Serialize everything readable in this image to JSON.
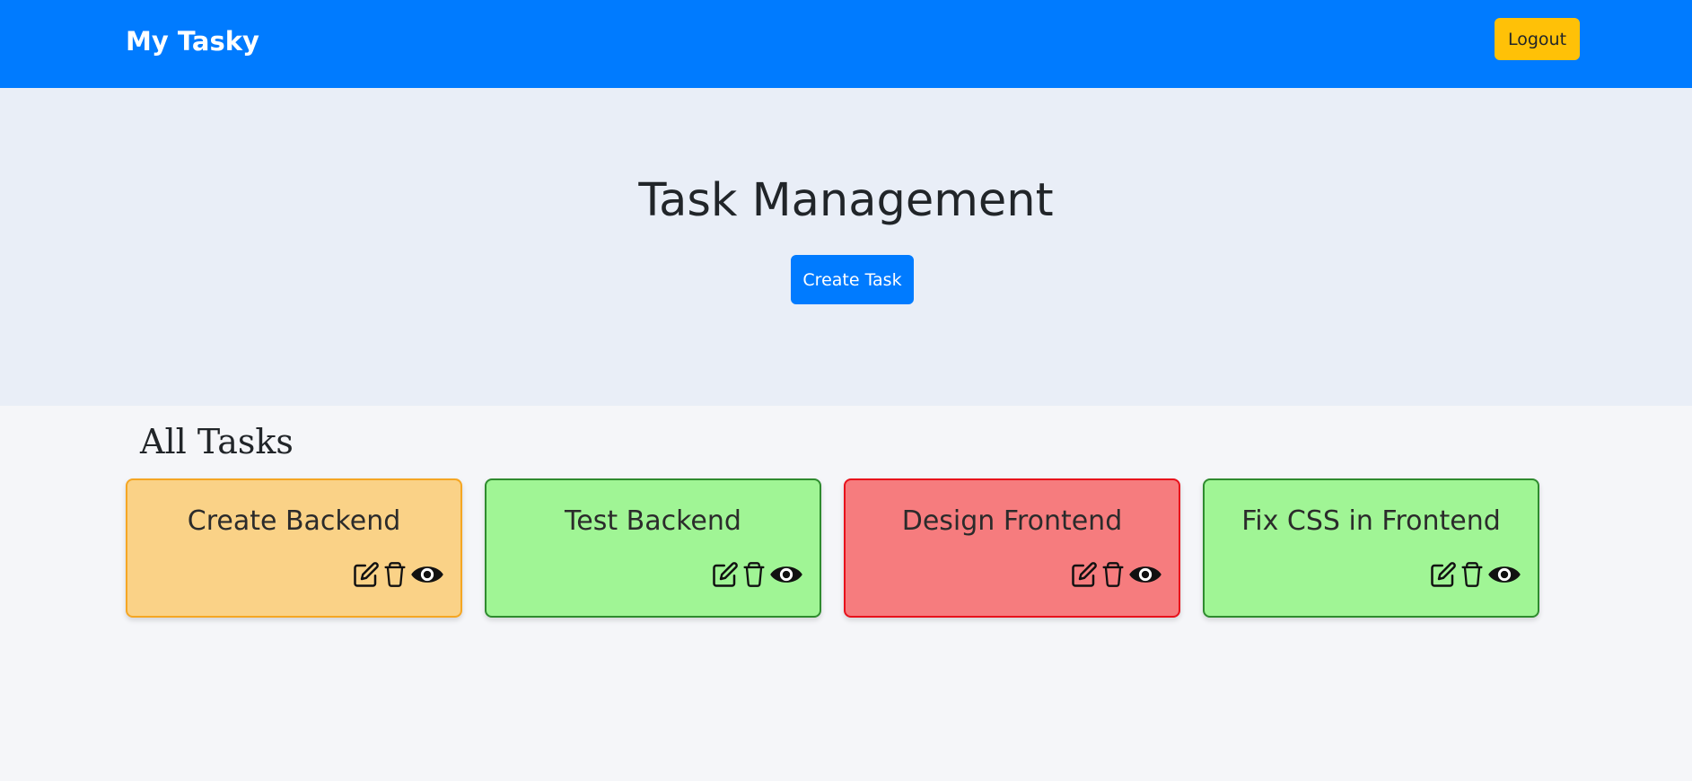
{
  "navbar": {
    "brand": "My Tasky",
    "logout_label": "Logout"
  },
  "hero": {
    "title": "Task Management",
    "create_label": "Create Task"
  },
  "tasks_section": {
    "title": "All Tasks"
  },
  "tasks": [
    {
      "title": "Create Backend",
      "status_color": {
        "background": "#fad287",
        "border": "#f5a623"
      }
    },
    {
      "title": "Test Backend",
      "status_color": {
        "background": "#a0f595",
        "border": "#2e8b2e"
      }
    },
    {
      "title": "Design Frontend",
      "status_color": {
        "background": "#f67c7e",
        "border": "#e8111b"
      }
    },
    {
      "title": "Fix CSS in Frontend",
      "status_color": {
        "background": "#a0f595",
        "border": "#2e8b2e"
      }
    }
  ],
  "icons": {
    "edit": "edit-icon",
    "delete": "trash-icon",
    "view": "eye-icon"
  },
  "colors": {
    "navbar": "#007bff",
    "logout_button": "#ffc107",
    "primary_button": "#007bff",
    "hero_background": "#e9eef7",
    "page_background": "#f5f6f9"
  }
}
